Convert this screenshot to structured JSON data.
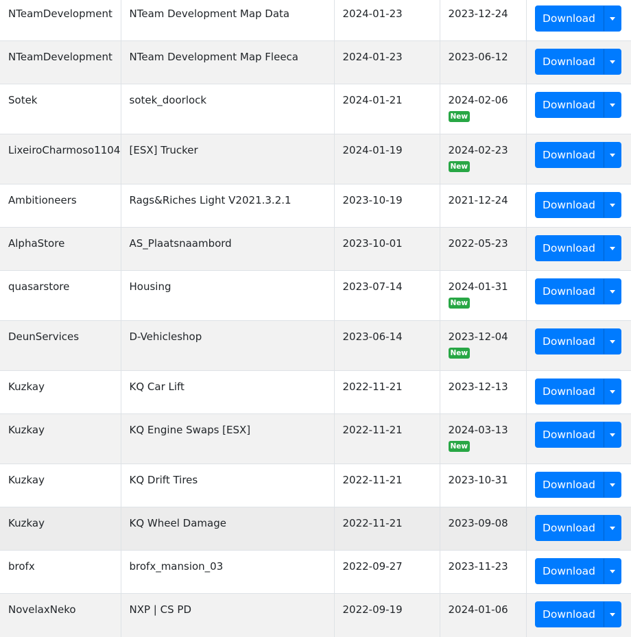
{
  "table": {
    "download_label": "Download",
    "new_badge_label": "New",
    "colors": {
      "button": "#007bff",
      "badge": "#28a745",
      "row_striped": "#f2f2f2",
      "row_hover": "#ececec"
    },
    "rows": [
      {
        "author": "NTeamDevelopment",
        "name": "NTeam Development Map Data",
        "released": "2024-01-23",
        "updated": "2023-12-24",
        "is_new": false
      },
      {
        "author": "NTeamDevelopment",
        "name": "NTeam Development Map Fleeca",
        "released": "2024-01-23",
        "updated": "2023-06-12",
        "is_new": false
      },
      {
        "author": "Sotek",
        "name": "sotek_doorlock",
        "released": "2024-01-21",
        "updated": "2024-02-06",
        "is_new": true
      },
      {
        "author": "LixeiroCharmoso1104",
        "name": "[ESX] Trucker",
        "released": "2024-01-19",
        "updated": "2024-02-23",
        "is_new": true
      },
      {
        "author": "Ambitioneers",
        "name": "Rags&Riches Light V2021.3.2.1",
        "released": "2023-10-19",
        "updated": "2021-12-24",
        "is_new": false
      },
      {
        "author": "AlphaStore",
        "name": "AS_Plaatsnaambord",
        "released": "2023-10-01",
        "updated": "2022-05-23",
        "is_new": false
      },
      {
        "author": "quasarstore",
        "name": "Housing",
        "released": "2023-07-14",
        "updated": "2024-01-31",
        "is_new": true
      },
      {
        "author": "DeunServices",
        "name": "D-Vehicleshop",
        "released": "2023-06-14",
        "updated": "2023-12-04",
        "is_new": true
      },
      {
        "author": "Kuzkay",
        "name": "KQ Car Lift",
        "released": "2022-11-21",
        "updated": "2023-12-13",
        "is_new": false
      },
      {
        "author": "Kuzkay",
        "name": "KQ Engine Swaps [ESX]",
        "released": "2022-11-21",
        "updated": "2024-03-13",
        "is_new": true
      },
      {
        "author": "Kuzkay",
        "name": "KQ Drift Tires",
        "released": "2022-11-21",
        "updated": "2023-10-31",
        "is_new": false
      },
      {
        "author": "Kuzkay",
        "name": "KQ Wheel Damage",
        "released": "2022-11-21",
        "updated": "2023-09-08",
        "is_new": false,
        "hovered": true
      },
      {
        "author": "brofx",
        "name": "brofx_mansion_03",
        "released": "2022-09-27",
        "updated": "2023-11-23",
        "is_new": false
      },
      {
        "author": "NovelaxNeko",
        "name": "NXP | CS PD",
        "released": "2022-09-19",
        "updated": "2024-01-06",
        "is_new": false
      }
    ]
  }
}
